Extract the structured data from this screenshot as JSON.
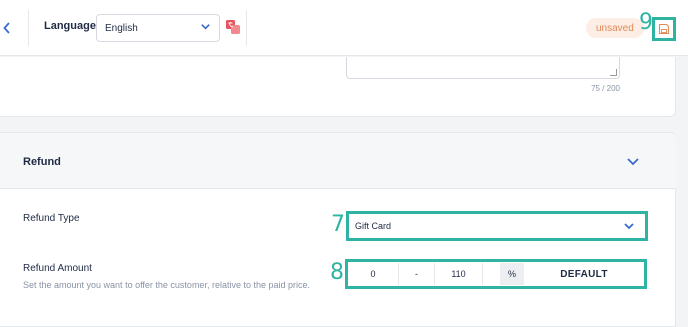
{
  "header": {
    "language_label": "Language",
    "language_value": "English",
    "status_badge": "unsaved"
  },
  "steps": {
    "save": "9",
    "refund_type": "7",
    "refund_amount": "8"
  },
  "description": {
    "counter": "75 / 200"
  },
  "refund": {
    "title": "Refund",
    "type_label": "Refund Type",
    "type_value": "Gift Card",
    "amount_label": "Refund Amount",
    "amount_help": "Set the amount you want to offer the customer, relative to the paid price.",
    "amount_min": "0",
    "amount_dash": "-",
    "amount_max": "110",
    "amount_unit": "%",
    "amount_default": "DEFAULT"
  },
  "colors": {
    "accent": "#2fb3a3",
    "link": "#3b6ad1",
    "badge_text": "#e08a58",
    "badge_bg": "#fdeee5"
  }
}
